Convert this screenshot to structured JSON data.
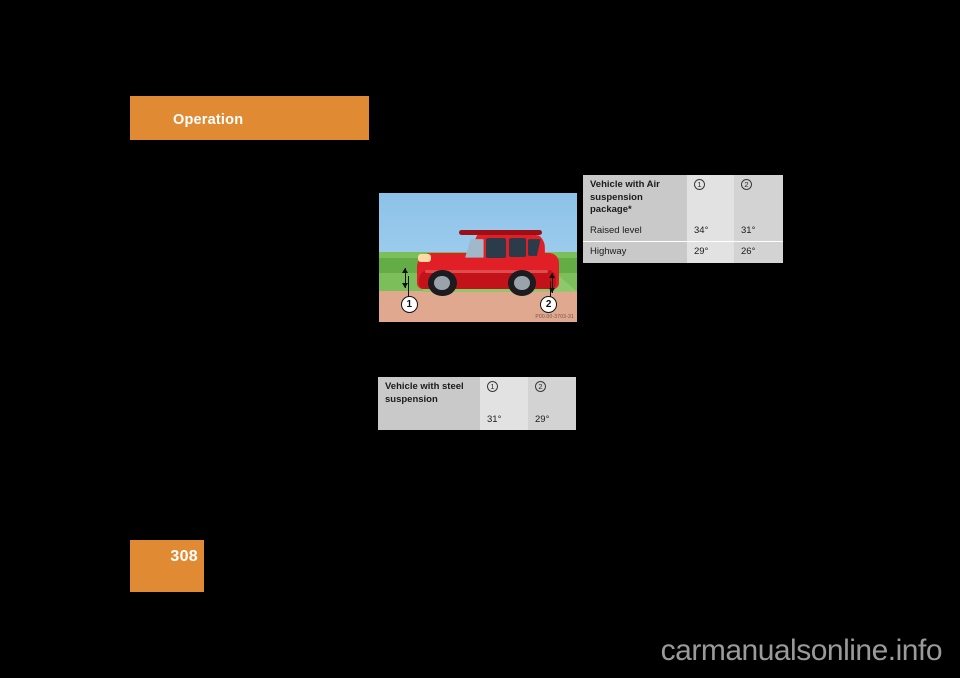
{
  "page": {
    "section_title": "Operation",
    "page_number": "308",
    "accent_color": "#e08b33",
    "background_color": "#000000"
  },
  "illustration": {
    "name": "vehicle-on-ramp-angles",
    "code": "P00.00-3703-31",
    "callouts": [
      {
        "id": "1",
        "label": "1"
      },
      {
        "id": "2",
        "label": "2"
      }
    ]
  },
  "tables": [
    {
      "id": "air-suspension",
      "header": {
        "label": "Vehicle with Air suspension package*",
        "col1": "1",
        "col2": "2"
      },
      "rows": [
        {
          "label": "Raised level",
          "col1": "34°",
          "col2": "31°"
        },
        {
          "label": "Highway",
          "col1": "29°",
          "col2": "26°"
        }
      ]
    },
    {
      "id": "steel-suspension",
      "header": {
        "label": "Vehicle with steel suspension",
        "col1": "1",
        "col2": "2"
      },
      "rows": [
        {
          "label": "",
          "col1": "31°",
          "col2": "29°"
        }
      ]
    }
  ],
  "watermark": {
    "text": "carmanualsonline.info"
  }
}
